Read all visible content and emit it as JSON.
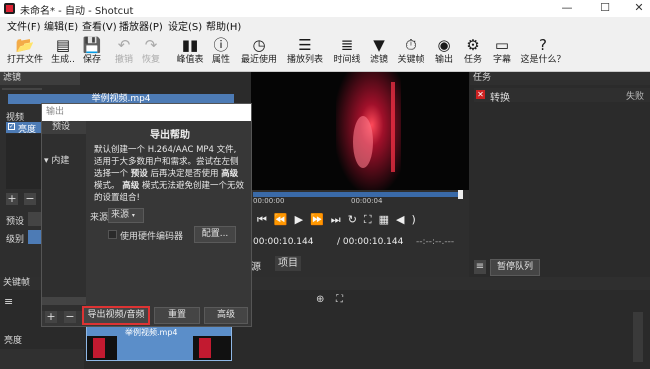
{
  "window": {
    "title": "未命名* - 自动 - Shotcut",
    "minimize": "—",
    "maximize": "☐",
    "close": "✕"
  },
  "menu": [
    "文件(F)",
    "编辑(E)",
    "查看(V)",
    "播放器(P)",
    "设定(S)",
    "帮助(H)"
  ],
  "toolbar": [
    {
      "label": "打开文件",
      "icon": "folder-open-icon",
      "glyph": "📂",
      "enabled": true
    },
    {
      "label": "生成..",
      "icon": "generate-icon",
      "glyph": "▤",
      "enabled": true
    },
    {
      "label": "保存",
      "icon": "save-icon",
      "glyph": "💾",
      "enabled": true
    },
    {
      "label": "撤销",
      "icon": "undo-icon",
      "glyph": "↶",
      "enabled": false
    },
    {
      "label": "恢复",
      "icon": "redo-icon",
      "glyph": "↷",
      "enabled": false
    },
    {
      "label": "峰值表",
      "icon": "peak-meter-icon",
      "glyph": "▮▮",
      "enabled": true
    },
    {
      "label": "属性",
      "icon": "properties-icon",
      "glyph": "ⓘ",
      "enabled": true
    },
    {
      "label": "最近使用",
      "icon": "recent-icon",
      "glyph": "◷",
      "enabled": true
    },
    {
      "label": "播放列表",
      "icon": "playlist-icon",
      "glyph": "☰",
      "enabled": true
    },
    {
      "label": "时间线",
      "icon": "timeline-icon",
      "glyph": "≣",
      "enabled": true
    },
    {
      "label": "滤镜",
      "icon": "filter-icon",
      "glyph": "▼",
      "enabled": true
    },
    {
      "label": "关键帧",
      "icon": "keyframe-icon",
      "glyph": "⏱",
      "enabled": true
    },
    {
      "label": "输出",
      "icon": "export-icon",
      "glyph": "◉",
      "enabled": true
    },
    {
      "label": "任务",
      "icon": "jobs-icon",
      "glyph": "⚙",
      "enabled": true
    },
    {
      "label": "字幕",
      "icon": "subtitles-icon",
      "glyph": "▭",
      "enabled": true
    },
    {
      "label": "这是什么？",
      "icon": "whats-this-icon",
      "glyph": "?",
      "enabled": true
    }
  ],
  "filters": {
    "header": "滤镜",
    "tab_video": "视频",
    "item": "亮度",
    "preset_label": "预设",
    "level_label": "级别",
    "add": "+",
    "remove": "−"
  },
  "clip_name": "举例视频.mp4",
  "export": {
    "search_placeholder": "输出",
    "preset_header": "预设",
    "tree_item": "内建",
    "help_title": "导出帮助",
    "help_line1": "默认创建一个 H.264/AAC MP4 文件,",
    "help_line2": "适用于大多数用户和需求。尝试在左侧",
    "help_line3_a": "选择一个",
    "help_line3_b": "预设",
    "help_line3_c": "后再决定是否使用",
    "help_line3_d": "高级",
    "help_line4_a": "模式。",
    "help_line4_b": "高级",
    "help_line4_c": "模式无法避免创建一个无效",
    "help_line5": "的设置组合!",
    "source_label": "来源",
    "source_value": "来源",
    "hw_encoder": "使用硬件编码器",
    "config_button": "配置...",
    "export_button": "导出视频/音频",
    "reset_button": "重置",
    "advanced_button": "高级",
    "add": "+",
    "remove": "−"
  },
  "player": {
    "ruler_start": "00:00:00",
    "ruler_end": "00:00:04",
    "current_time": "00:00:10.144",
    "total_time": "/ 00:00:10.144",
    "in_out": "--:--:--.---",
    "tab_source": "源",
    "tab_project": "项目"
  },
  "jobs": {
    "header": "任务",
    "job_name": "转换",
    "job_status": "失败",
    "pause_button": "暂停队列",
    "menu_icon": "≡"
  },
  "timeline": {
    "header": "关键帧",
    "track_label": "亮度",
    "clip_label": "举例视频.mp4"
  },
  "colors": {
    "accent": "#4d7bb5",
    "danger": "#d33333",
    "clip": "#5b8ec9"
  }
}
